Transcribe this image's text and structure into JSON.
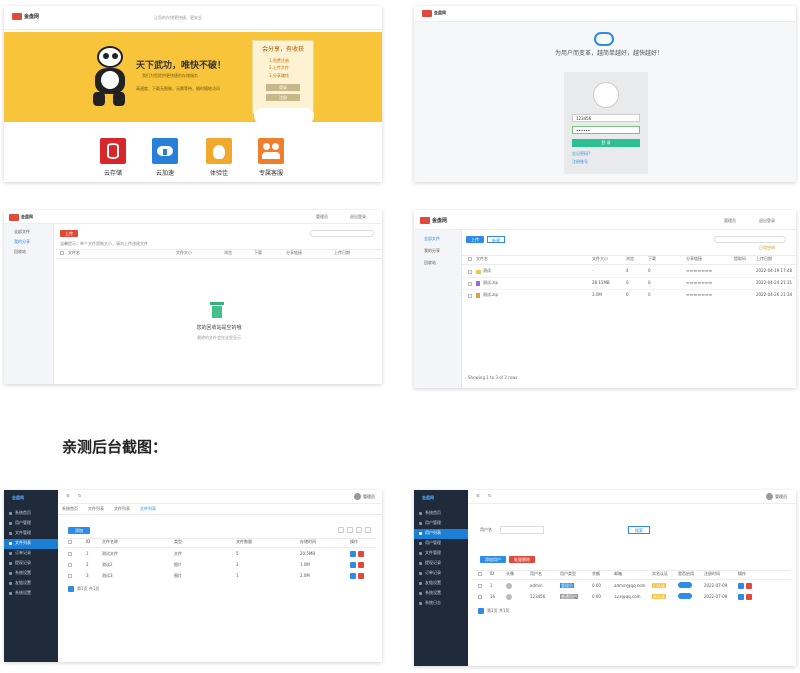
{
  "section_title": "亲测后台截图：",
  "home": {
    "logo": "金盘网",
    "top_slogan": "让您的存储更快捷、更安全",
    "hero_headline": "天下武功，唯快不破！",
    "hero_sub": "我们为您提供更快捷的存储服务",
    "hero_features": "高速度、下载无限制、无需等待、随时随地访问",
    "share_box_title": "会分享，有收获",
    "share_steps": [
      "1.免费注册",
      "2.上传文件",
      "3.分享赚钱"
    ],
    "login_btn": "登录",
    "register_btn": "注册",
    "features": [
      {
        "label": "云存储",
        "icon": "database-icon",
        "color": "#d9262b"
      },
      {
        "label": "云加速",
        "icon": "cloud-download-icon",
        "color": "#2a7fd6"
      },
      {
        "label": "体验佳",
        "icon": "money-bag-icon",
        "color": "#f0a92c"
      },
      {
        "label": "专属客服",
        "icon": "customer-service-icon",
        "color": "#ef7f2a"
      }
    ]
  },
  "login": {
    "headline": "为用户而变革，越简单越好，越快越好！",
    "username": "123456",
    "password": "••••••",
    "submit": "登 录",
    "links": [
      "忘记密码?",
      "注册账号"
    ]
  },
  "file_empty": {
    "user_label": "管理员",
    "logout": "退出登录",
    "nav": [
      "全部文件",
      "我的分享",
      "回收站"
    ],
    "upload_btn": "上传",
    "search_placeholder": "搜索文件",
    "notice": "温馨提示：单个文件限制大小，请勿上传违规文件",
    "columns": [
      "文件名",
      "文件大小",
      "浏览",
      "下载",
      "分享链接",
      "上传日期"
    ],
    "empty_title": "您的回收站是空的哦",
    "empty_sub": "删除的文件会在这里显示"
  },
  "file_list": {
    "user_label": "管理员",
    "logout": "退出登录",
    "nav": [
      "全部文件",
      "我的分享",
      "回收站"
    ],
    "upload_btn": "上传",
    "folder_btn": "新建",
    "notice": "已用空间",
    "columns": [
      "文件名",
      "文件大小",
      "浏览",
      "下载",
      "分享链接",
      "提取码",
      "上传日期"
    ],
    "rows": [
      {
        "name": "测试",
        "size": "-",
        "views": "4",
        "downloads": "0",
        "date": "2022-04-19 17:48"
      },
      {
        "name": "测试.zip",
        "size": "28.15MB",
        "views": "0",
        "downloads": "0",
        "date": "2022-04-24 21:31"
      },
      {
        "name": "测试.zip",
        "size": "3.0M",
        "views": "0",
        "downloads": "0",
        "date": "2022-04-26 21:34"
      }
    ],
    "footer": "Showing 1 to 3 of 3 rows"
  },
  "admin_files": {
    "brand": "金盘网",
    "user": "管理员",
    "menu": [
      "系统首页",
      "用户管理",
      "文件管理",
      "文件列表",
      "订单记录",
      "提现记录",
      "系统设置",
      "友链设置",
      "系统设置"
    ],
    "tabs": [
      "系统首页",
      "文件列表",
      "文件列表",
      "文件列表"
    ],
    "add_btn": "添加",
    "columns": [
      "ID",
      "文件名称",
      "类型",
      "文件数量",
      "存储时间",
      "操作"
    ],
    "rows": [
      {
        "id": "1",
        "name": "测试文件",
        "type": "文件",
        "count": "5",
        "time": "20.5MB"
      },
      {
        "id": "2",
        "name": "测试2",
        "type": "图片",
        "count": "3",
        "time": "1.0M"
      },
      {
        "id": "3",
        "name": "测试3",
        "type": "图片",
        "count": "1",
        "time": "2.0M"
      }
    ],
    "pager": "第1页 共1页"
  },
  "admin_users": {
    "brand": "金盘网",
    "user": "管理员",
    "menu": [
      "系统首页",
      "用户管理",
      "用户列表",
      "用户管理",
      "文件管理",
      "提现记录",
      "订单记录",
      "友链设置",
      "系统设置",
      "系统日志"
    ],
    "search_label": "用户名",
    "search_btn": "搜索",
    "add_btn": "添加用户",
    "del_btn": "批量删除",
    "columns": [
      "ID",
      "头像",
      "用户名",
      "用户类型",
      "余额",
      "邮箱",
      "实名认证",
      "是否启用",
      "注册时间",
      "操作"
    ],
    "rows": [
      {
        "id": "1",
        "name": "admin",
        "type": "管理员",
        "balance": "0.00",
        "email": "admin@qq.com",
        "verified": "已认证",
        "date": "2022-07-09"
      },
      {
        "id": "16",
        "name": "123456",
        "type": "普通用户",
        "balance": "0.00",
        "email": "123@qq.com",
        "verified": "未认证",
        "date": "2022-07-09"
      }
    ],
    "pager": "第1页 共1页"
  }
}
